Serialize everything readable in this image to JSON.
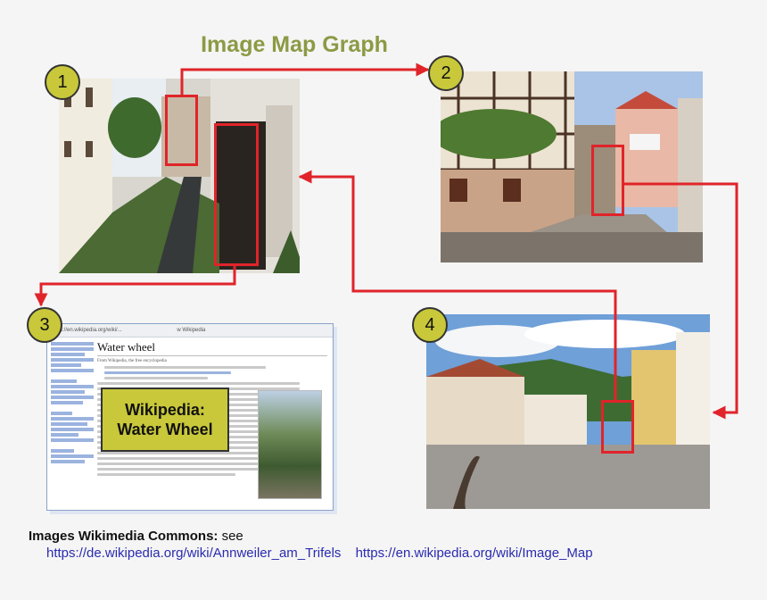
{
  "title": "Image Map Graph",
  "nodes": [
    {
      "number": "1",
      "subject": "water-wheel-street-photo"
    },
    {
      "number": "2",
      "subject": "half-timbered-lane-photo"
    },
    {
      "number": "3",
      "subject": "wikipedia-screenshot"
    },
    {
      "number": "4",
      "subject": "town-square-photo"
    }
  ],
  "wikipedia_page": {
    "url": "https://en.wikipedia.org/wiki/...",
    "tab_label": "w Wikipedia",
    "heading": "Water wheel",
    "tagline": "From Wikipedia, the free encyclopedia",
    "overlay_label_line1": "Wikipedia:",
    "overlay_label_line2": "Water Wheel"
  },
  "credit": {
    "label": "Images Wikimedia Commons:",
    "suffix": " see",
    "link1": "https://de.wikipedia.org/wiki/Annweiler_am_Trifels",
    "link2": "https://en.wikipedia.org/wiki/Image_Map"
  },
  "colors": {
    "badge": "#c8c83a",
    "arrow": "#e0242a",
    "title": "#8c9a45",
    "link": "#2b2bb0"
  }
}
